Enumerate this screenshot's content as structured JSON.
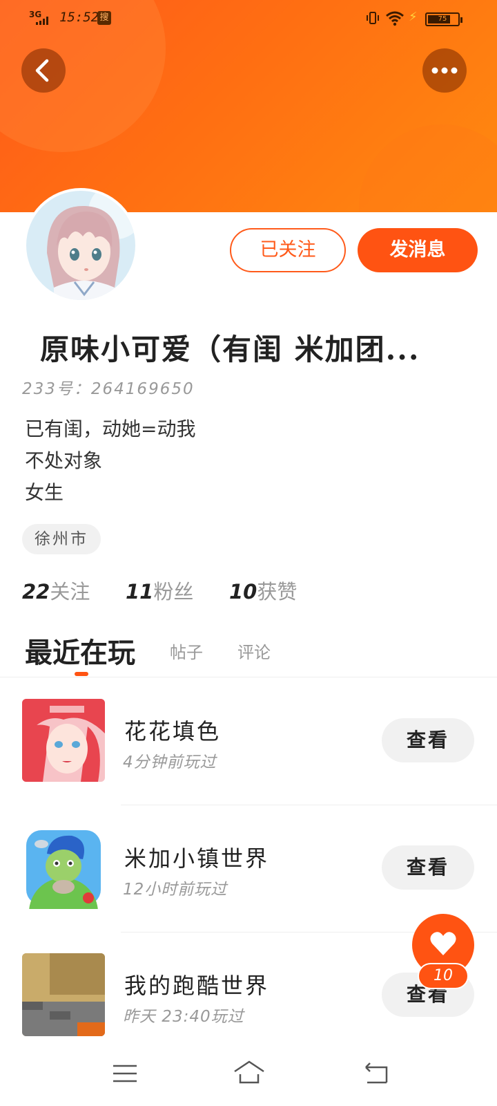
{
  "status_bar": {
    "network": "3G",
    "time": "15:52",
    "app_badge": "搜",
    "battery_level": "75"
  },
  "profile": {
    "name": "原味小可爱（有闺 米加团...",
    "uid": "233号：264169650",
    "bio": [
      "已有闺，动她=动我",
      "不处对象",
      "女生"
    ],
    "location": "徐州市",
    "follow_button": "已关注",
    "message_button": "发消息"
  },
  "stats": [
    {
      "num": "22",
      "label": "关注"
    },
    {
      "num": "11",
      "label": "粉丝"
    },
    {
      "num": "10",
      "label": "获赞"
    }
  ],
  "tabs": [
    {
      "label": "最近在玩",
      "active": true
    },
    {
      "label": "帖子",
      "active": false
    },
    {
      "label": "评论",
      "active": false
    }
  ],
  "games": [
    {
      "title": "花花填色",
      "sub": "4分钟前玩过",
      "button": "查看",
      "icon": "coloring-game-thumbnail"
    },
    {
      "title": "米加小镇世界",
      "sub": "12小时前玩过",
      "button": "查看",
      "icon": "town-world-thumbnail"
    },
    {
      "title": "我的跑酷世界",
      "sub": "昨天 23:40玩过",
      "button": "查看",
      "icon": "parkour-world-thumbnail"
    }
  ],
  "like_fab": {
    "count": "10"
  },
  "colors": {
    "accent": "#ff5312",
    "banner": "#ff6f12",
    "muted": "#999999"
  }
}
